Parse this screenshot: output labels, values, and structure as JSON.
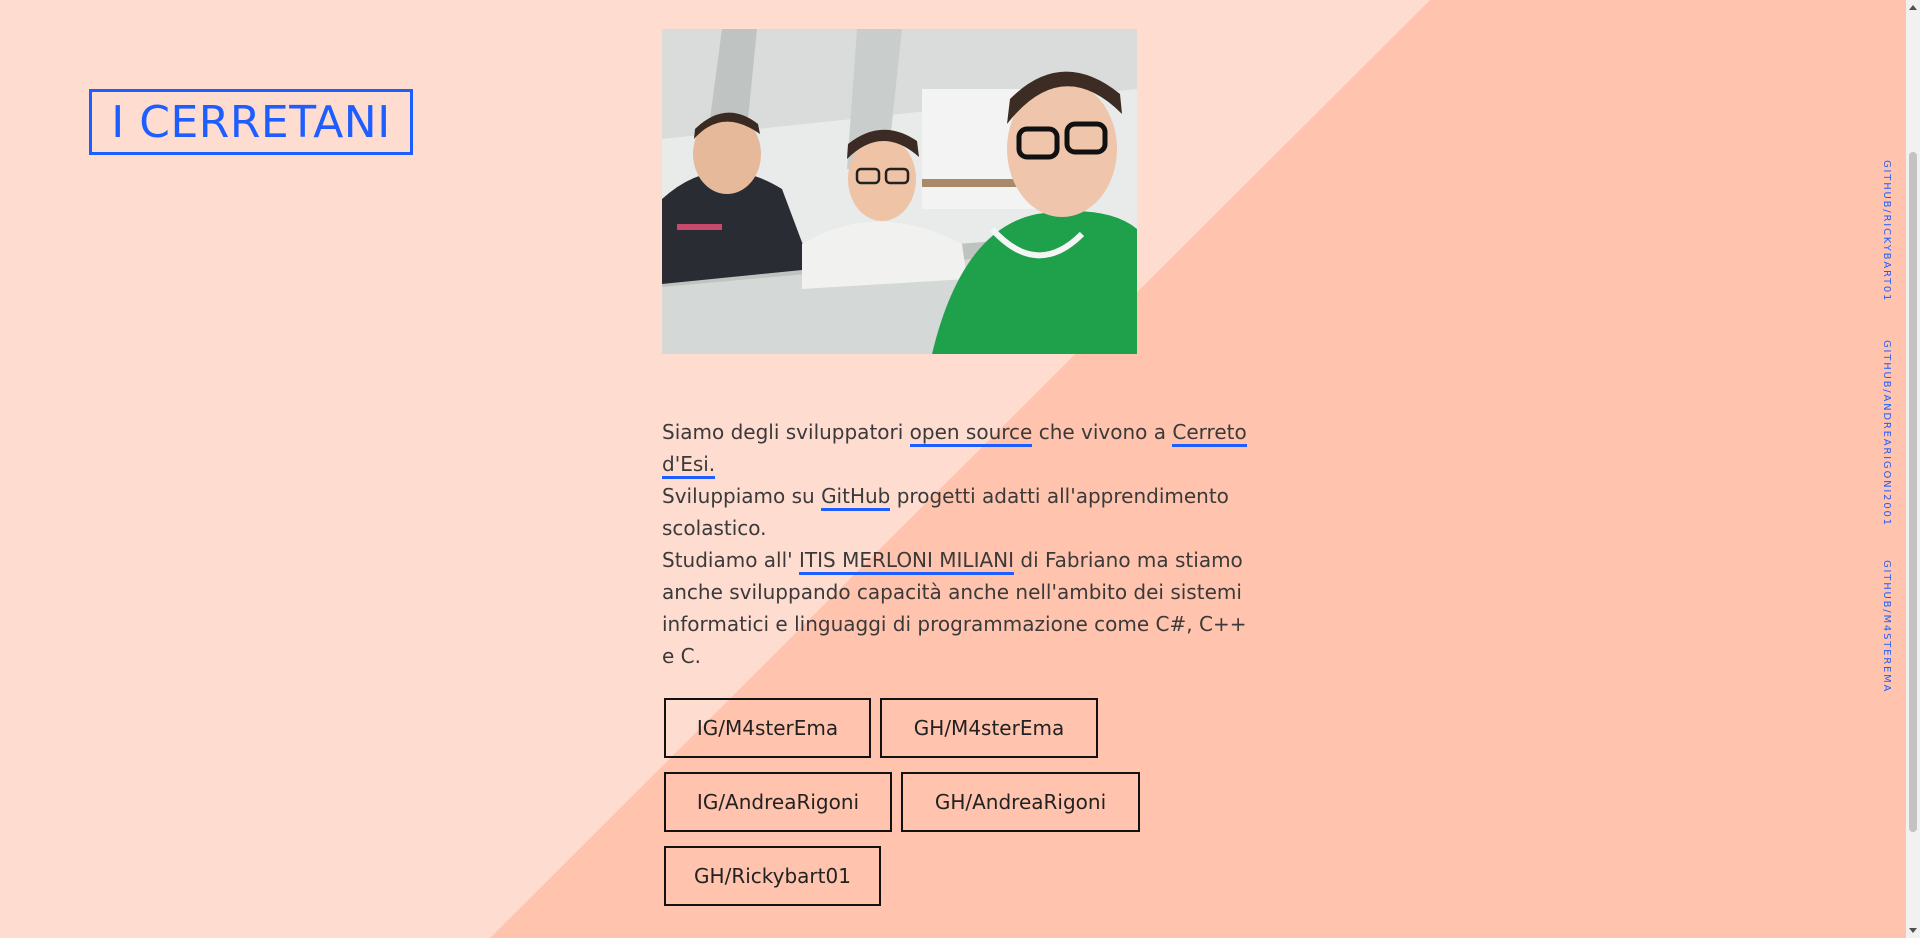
{
  "colors": {
    "background_light": "#FFDCD0",
    "background_dark": "#FFC3AE",
    "accent_blue": "#1E5EFF",
    "text": "#3a3a3a"
  },
  "header": {
    "logo_text": "I CERRETANI"
  },
  "hero_image": {
    "alt": "Three smiling young men in a selfie"
  },
  "intro": {
    "line1_pre": "Siamo degli sviluppatori ",
    "link_open_source": "open source",
    "line1_mid": " che vivono a ",
    "link_cerreto": "Cerreto d'Esi.",
    "line2_pre": "Sviluppiamo su ",
    "link_github": "GitHub",
    "line2_post": " progetti adatti all'apprendimento scolastico.",
    "line3_pre": "Studiamo all' ",
    "link_itis": "ITIS MERLONI MILIANI",
    "line3_post": " di Fabriano ma stiamo anche sviluppando capacità anche nell'ambito dei sistemi informatici e linguaggi di programmazione come C#, C++ e C."
  },
  "buttons": {
    "ig_m4sterema": "IG/M4sterEma",
    "gh_m4sterema": "GH/M4sterEma",
    "ig_andrearigoni": "IG/AndreaRigoni",
    "gh_andrearigoni": "GH/AndreaRigoni",
    "gh_rickybart01": "GH/Rickybart01"
  },
  "side_links": {
    "rickybart": "GITHUB/RICKYBART01",
    "andrearigoni": "GITHUB/ANDREARIGONI2001",
    "m4sterema": "GITHUB/M4STEREMA"
  }
}
